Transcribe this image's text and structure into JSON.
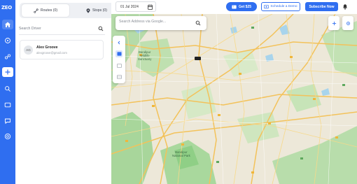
{
  "app": {
    "logo": "ZEO"
  },
  "rail": {
    "items": [
      {
        "icon": "home-icon"
      },
      {
        "icon": "route-icon"
      },
      {
        "icon": "analytics-icon"
      },
      {
        "icon": "add-icon"
      },
      {
        "icon": "search-icon"
      },
      {
        "icon": "message-icon"
      },
      {
        "icon": "chat-icon"
      },
      {
        "icon": "help-icon"
      }
    ]
  },
  "panel": {
    "tabs": [
      {
        "label": "Routes (0)",
        "icon": "route-icon"
      },
      {
        "label": "Stops (0)",
        "icon": "pin-icon"
      }
    ],
    "search_placeholder": "Search Driver",
    "drivers": [
      {
        "initials": "AG",
        "name": "Alex Groove",
        "email": "alexgroove@gmail.com"
      }
    ]
  },
  "topbar": {
    "date": "01 Jul 2024",
    "get_label": "Get $25",
    "demo_label": "Schedule a Demo",
    "subscribe_label": "Subscribe Now"
  },
  "map": {
    "search_placeholder": "Search Address via Google...",
    "labels": {
      "nw": "Bandipur\nWildlife\nSanctuary",
      "south": "Bandipur\nNational Park"
    }
  },
  "colors": {
    "accent": "#2f6ef0",
    "rail": "#2f6ef0",
    "road": "#f6c14a",
    "park": "#9fd39a"
  }
}
